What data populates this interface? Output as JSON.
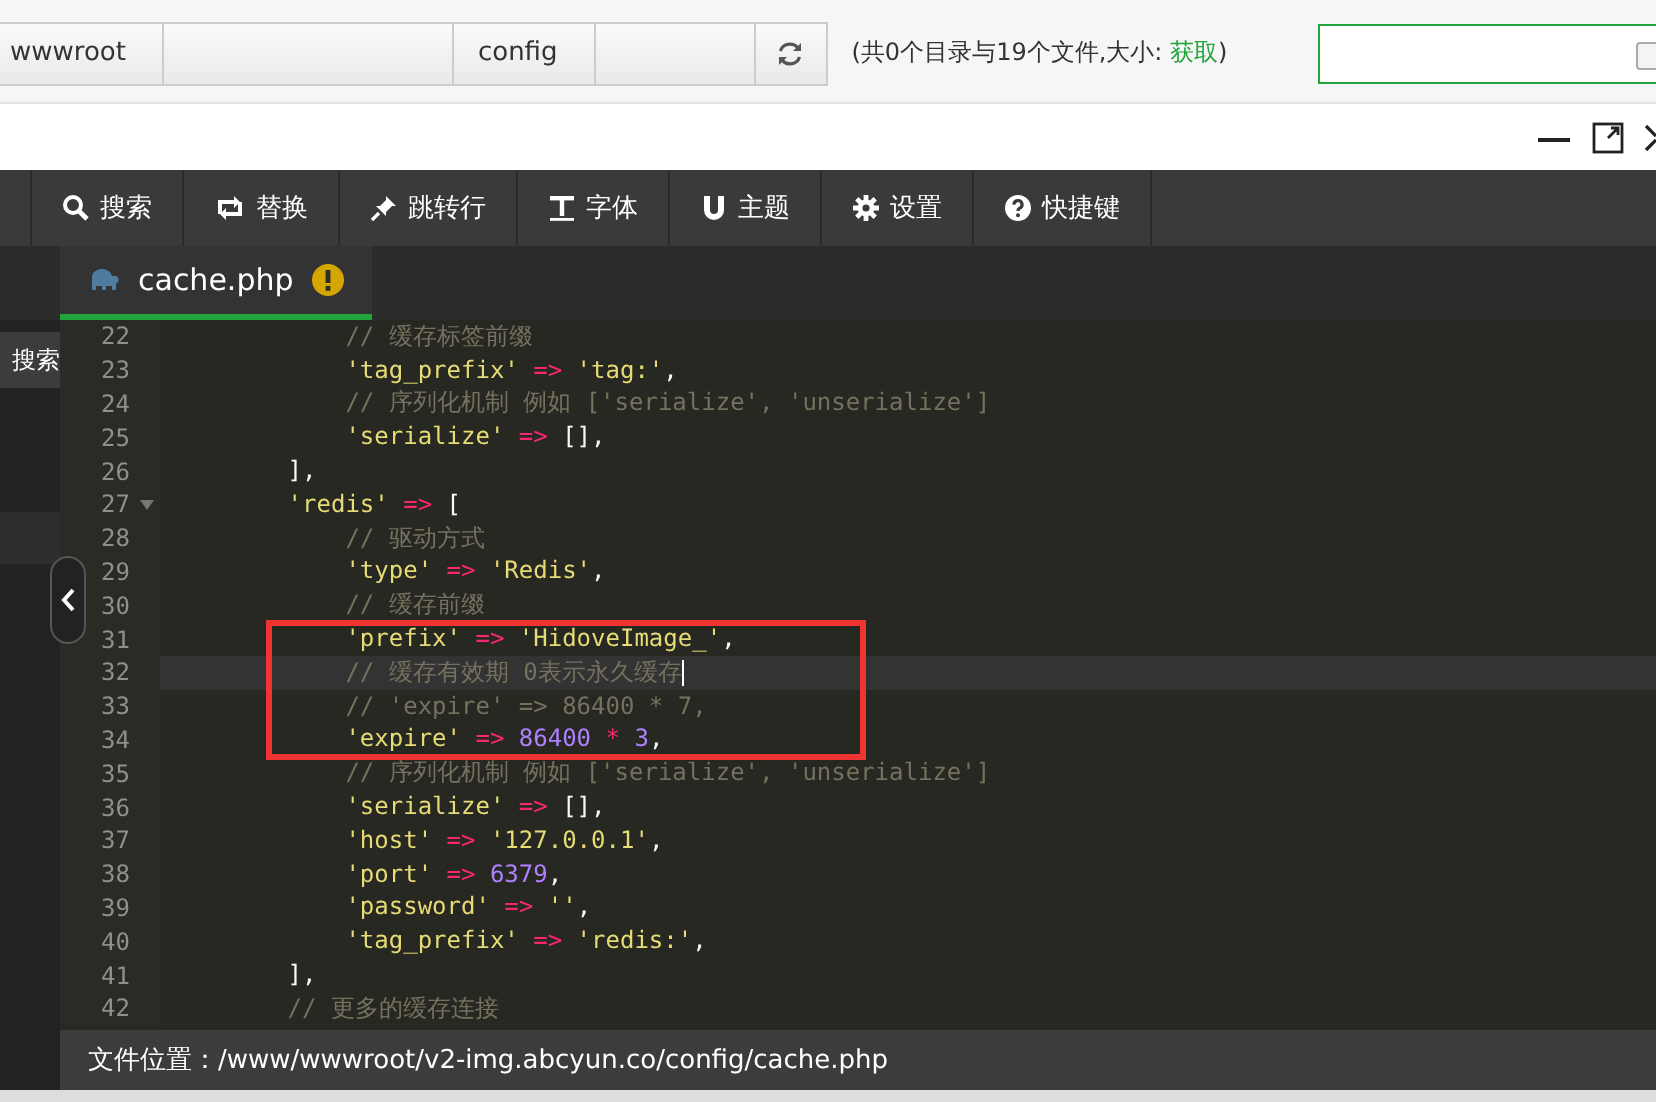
{
  "breadcrumb": {
    "segments": [
      {
        "label": "wwwroot"
      },
      {
        "label": "config"
      }
    ],
    "summary": "(共0个目录与19个文件,大小: ",
    "summary_link": "获取",
    "summary_end": ")"
  },
  "toolbar": [
    {
      "kind": "search",
      "label": "搜索"
    },
    {
      "kind": "replace",
      "label": "替换"
    },
    {
      "kind": "jump",
      "label": "跳转行"
    },
    {
      "kind": "font",
      "label": "字体"
    },
    {
      "kind": "theme",
      "label": "主题"
    },
    {
      "kind": "settings",
      "label": "设置"
    },
    {
      "kind": "help",
      "label": "快捷键"
    }
  ],
  "side_search": "搜索",
  "tab": {
    "label": "cache.php",
    "modified": true,
    "selected": true
  },
  "lines": [
    {
      "no": "22",
      "current": false,
      "foldable": false,
      "tokens": [
        {
          "kind": "c",
          "t": "            // 缓存标签前缀"
        }
      ]
    },
    {
      "no": "23",
      "current": false,
      "foldable": false,
      "tokens": [
        {
          "kind": "s",
          "t": "            'tag_prefix'"
        },
        {
          "kind": "o",
          "t": " => "
        },
        {
          "kind": "s",
          "t": "'tag:'"
        },
        {
          "kind": "p",
          "t": ","
        }
      ]
    },
    {
      "no": "24",
      "current": false,
      "foldable": false,
      "tokens": [
        {
          "kind": "c",
          "t": "            // 序列化机制 例如 ['serialize', 'unserialize']"
        }
      ]
    },
    {
      "no": "25",
      "current": false,
      "foldable": false,
      "tokens": [
        {
          "kind": "s",
          "t": "            'serialize'"
        },
        {
          "kind": "o",
          "t": " => "
        },
        {
          "kind": "p",
          "t": "[],"
        }
      ]
    },
    {
      "no": "26",
      "current": false,
      "foldable": false,
      "tokens": [
        {
          "kind": "p",
          "t": "        ],"
        }
      ]
    },
    {
      "no": "27",
      "current": false,
      "foldable": true,
      "tokens": [
        {
          "kind": "s",
          "t": "        'redis'"
        },
        {
          "kind": "o",
          "t": " => "
        },
        {
          "kind": "p",
          "t": "["
        }
      ]
    },
    {
      "no": "28",
      "current": false,
      "foldable": false,
      "tokens": [
        {
          "kind": "c",
          "t": "            // 驱动方式"
        }
      ]
    },
    {
      "no": "29",
      "current": false,
      "foldable": false,
      "tokens": [
        {
          "kind": "s",
          "t": "            'type'"
        },
        {
          "kind": "o",
          "t": " => "
        },
        {
          "kind": "s",
          "t": "'Redis'"
        },
        {
          "kind": "p",
          "t": ","
        }
      ]
    },
    {
      "no": "30",
      "current": false,
      "foldable": false,
      "tokens": [
        {
          "kind": "c",
          "t": "            // 缓存前缀"
        }
      ]
    },
    {
      "no": "31",
      "current": false,
      "foldable": false,
      "tokens": [
        {
          "kind": "s",
          "t": "            'prefix'"
        },
        {
          "kind": "o",
          "t": " => "
        },
        {
          "kind": "s",
          "t": "'HidoveImage_'"
        },
        {
          "kind": "p",
          "t": ","
        }
      ]
    },
    {
      "no": "32",
      "current": true,
      "foldable": false,
      "tokens": [
        {
          "kind": "c",
          "t": "            // 缓存有效期 0表示永久缓存"
        }
      ]
    },
    {
      "no": "33",
      "current": false,
      "foldable": false,
      "tokens": [
        {
          "kind": "c",
          "t": "            // 'expire' => 86400 * 7,"
        }
      ]
    },
    {
      "no": "34",
      "current": false,
      "foldable": false,
      "tokens": [
        {
          "kind": "s",
          "t": "            'expire'"
        },
        {
          "kind": "o",
          "t": " => "
        },
        {
          "kind": "n",
          "t": "86400"
        },
        {
          "kind": "o",
          "t": " * "
        },
        {
          "kind": "n",
          "t": "3"
        },
        {
          "kind": "p",
          "t": ","
        }
      ]
    },
    {
      "no": "35",
      "current": false,
      "foldable": false,
      "tokens": [
        {
          "kind": "c",
          "t": "            // 序列化机制 例如 ['serialize', 'unserialize']"
        }
      ]
    },
    {
      "no": "36",
      "current": false,
      "foldable": false,
      "tokens": [
        {
          "kind": "s",
          "t": "            'serialize'"
        },
        {
          "kind": "o",
          "t": " => "
        },
        {
          "kind": "p",
          "t": "[],"
        }
      ]
    },
    {
      "no": "37",
      "current": false,
      "foldable": false,
      "tokens": [
        {
          "kind": "s",
          "t": "            'host'"
        },
        {
          "kind": "o",
          "t": " => "
        },
        {
          "kind": "s",
          "t": "'127.0.0.1'"
        },
        {
          "kind": "p",
          "t": ","
        }
      ]
    },
    {
      "no": "38",
      "current": false,
      "foldable": false,
      "tokens": [
        {
          "kind": "s",
          "t": "            'port'"
        },
        {
          "kind": "o",
          "t": " => "
        },
        {
          "kind": "n",
          "t": "6379"
        },
        {
          "kind": "p",
          "t": ","
        }
      ]
    },
    {
      "no": "39",
      "current": false,
      "foldable": false,
      "tokens": [
        {
          "kind": "s",
          "t": "            'password'"
        },
        {
          "kind": "o",
          "t": " => "
        },
        {
          "kind": "s",
          "t": "''"
        },
        {
          "kind": "p",
          "t": ","
        }
      ]
    },
    {
      "no": "40",
      "current": false,
      "foldable": false,
      "tokens": [
        {
          "kind": "s",
          "t": "            'tag_prefix'"
        },
        {
          "kind": "o",
          "t": " => "
        },
        {
          "kind": "s",
          "t": "'redis:'"
        },
        {
          "kind": "p",
          "t": ","
        }
      ]
    },
    {
      "no": "41",
      "current": false,
      "foldable": false,
      "tokens": [
        {
          "kind": "p",
          "t": "        ],"
        }
      ]
    },
    {
      "no": "42",
      "current": false,
      "foldable": false,
      "tokens": [
        {
          "kind": "c",
          "t": "        // 更多的缓存连接"
        }
      ]
    }
  ],
  "status_bar": "文件位置：/www/wwwroot/v2-img.abcyun.co/config/cache.php"
}
